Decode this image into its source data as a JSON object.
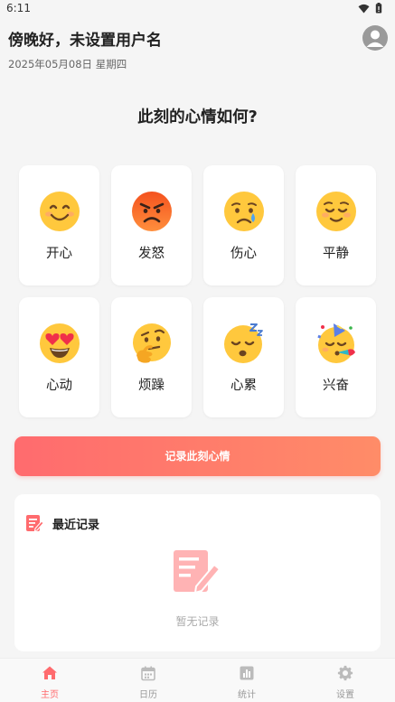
{
  "status_bar": {
    "time": "6:11"
  },
  "header": {
    "greeting": "傍晚好，未设置用户名",
    "date": "2025年05月08日 星期四"
  },
  "question": "此刻的心情如何?",
  "moods": [
    {
      "label": "开心",
      "icon": "smiling-face-icon"
    },
    {
      "label": "发怒",
      "icon": "angry-face-icon"
    },
    {
      "label": "伤心",
      "icon": "crying-face-icon"
    },
    {
      "label": "平静",
      "icon": "relieved-face-icon"
    },
    {
      "label": "心动",
      "icon": "heart-eyes-face-icon"
    },
    {
      "label": "烦躁",
      "icon": "thinking-face-icon"
    },
    {
      "label": "心累",
      "icon": "sleepy-face-icon"
    },
    {
      "label": "兴奋",
      "icon": "party-face-icon"
    }
  ],
  "record_button": {
    "label": "记录此刻心情"
  },
  "recent": {
    "title": "最近记录",
    "empty_text": "暂无记录"
  },
  "nav": {
    "items": [
      {
        "label": "主页",
        "icon": "home-icon"
      },
      {
        "label": "日历",
        "icon": "calendar-icon"
      },
      {
        "label": "统计",
        "icon": "chart-icon"
      },
      {
        "label": "设置",
        "icon": "gear-icon"
      }
    ]
  },
  "colors": {
    "accent": "#ff6b6e",
    "accent_end": "#ff8c68",
    "background": "#f5f5f5",
    "emoji_yellow": "#ffc83d",
    "emoji_angry": "#f4511e"
  }
}
